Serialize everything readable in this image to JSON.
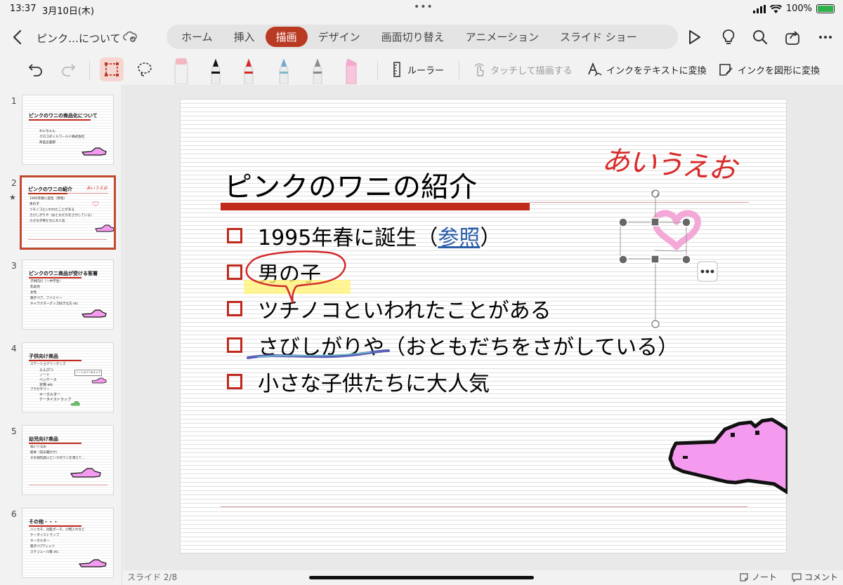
{
  "status_bar": {
    "time": "13:37",
    "date": "3月10日(木)",
    "battery": "100%",
    "battery_level": 1.0
  },
  "header": {
    "doc_title": "ピンク…について",
    "tabs": [
      {
        "label": "ホーム",
        "active": false
      },
      {
        "label": "挿入",
        "active": false
      },
      {
        "label": "描画",
        "active": true
      },
      {
        "label": "デザイン",
        "active": false
      },
      {
        "label": "画面切り替え",
        "active": false
      },
      {
        "label": "アニメーション",
        "active": false
      },
      {
        "label": "スライド ショー",
        "active": false
      }
    ],
    "accent_color": "#b93a23"
  },
  "toolbar": {
    "ruler_label": "ルーラー",
    "touch_draw_label": "タッチして描画する",
    "ink_to_text_label": "インクをテキストに変換",
    "ink_to_shape_label": "インクを図形に変換",
    "pens": [
      {
        "name": "pink-highlighter",
        "color": "#f2b8c0"
      },
      {
        "name": "black-pen",
        "color": "#111111"
      },
      {
        "name": "red-pen",
        "color": "#d42a2a"
      },
      {
        "name": "galaxy-pen",
        "color": "#6fa8d6"
      },
      {
        "name": "pencil",
        "color": "#8a8a8a"
      },
      {
        "name": "pink-marker",
        "color": "#f6a8d0"
      }
    ]
  },
  "thumbnails": [
    {
      "number": "1",
      "title": "ピンクのワニの商品化について",
      "lines": [
        "わにちゃん",
        "クロコダイルワールド株式会社",
        "商品企画部"
      ]
    },
    {
      "number": "2",
      "title": "ピンクのワニの紹介",
      "handwriting": "あいうえお",
      "lines": [
        "1995年春に誕生（参照）",
        "男の子",
        "ツチノコといわれたことがある",
        "さびしがりや（おともだちをさがしている）",
        "小さな子供たちに大人気"
      ]
    },
    {
      "number": "3",
      "title": "ピンクのワニ商品が受ける客層",
      "lines": [
        "子供向け（～中学生）",
        "乳幼児",
        "女性",
        "親子ペア、ファミリー",
        "キャラクターグッズ好きな方 etc"
      ]
    },
    {
      "number": "4",
      "title": "子供向け商品",
      "lines": [
        "ステーショナリーグッズ",
        "えんぴつ",
        "ノート",
        "ペンケース",
        "定規 etc",
        "アクセサリー",
        "キーホルダー",
        "ケータイストラップ"
      ],
      "callout": "ノートカバーのキャラ"
    },
    {
      "number": "5",
      "title": "幼児向け商品",
      "lines": [
        "ぬいぐるみ",
        "絵本（読み聞かせ）",
        "その他玩具にピンクのワニを添えて…"
      ]
    },
    {
      "number": "6",
      "title": "その他・・・",
      "lines": [
        "ハンカチ、化粧ポーチ、小物入れなど",
        "ケータイストラップ",
        "キーホルダー",
        "親子ペアTシャツ",
        "スケジュール帳 etc"
      ]
    }
  ],
  "slide": {
    "title": "ピンクのワニの紹介",
    "handwriting": "あいうえお",
    "bullets": [
      {
        "before": "1995年春に誕生（",
        "link": "参照",
        "after": "）"
      },
      {
        "before": "男の子",
        "link": "",
        "after": ""
      },
      {
        "before": "ツチノコといわれたことがある",
        "link": "",
        "after": ""
      },
      {
        "before": "さびしがりや（おともだちをさがしている）",
        "link": "",
        "after": ""
      },
      {
        "before": "小さな子供たちに大人気",
        "link": "",
        "after": ""
      }
    ]
  },
  "footer": {
    "slide_counter": "スライド 2/8",
    "notes_label": "ノート",
    "comments_label": "コメント"
  }
}
